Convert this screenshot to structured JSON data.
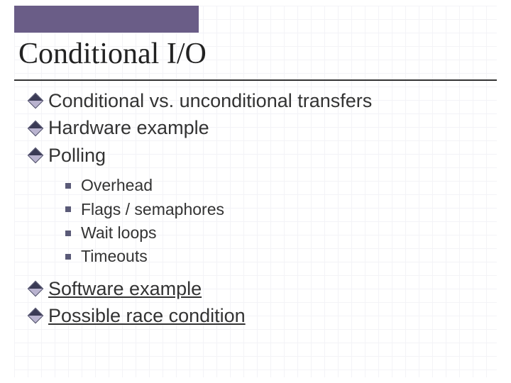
{
  "title": "Conditional I/O",
  "bullets": {
    "b1": "Conditional vs. unconditional transfers",
    "b2": "Hardware example",
    "b3": "Polling",
    "sub": {
      "s1": "Overhead",
      "s2": "Flags / semaphores",
      "s3": "Wait loops",
      "s4": "Timeouts"
    },
    "b4": "Software example",
    "b5": "Possible race condition"
  }
}
